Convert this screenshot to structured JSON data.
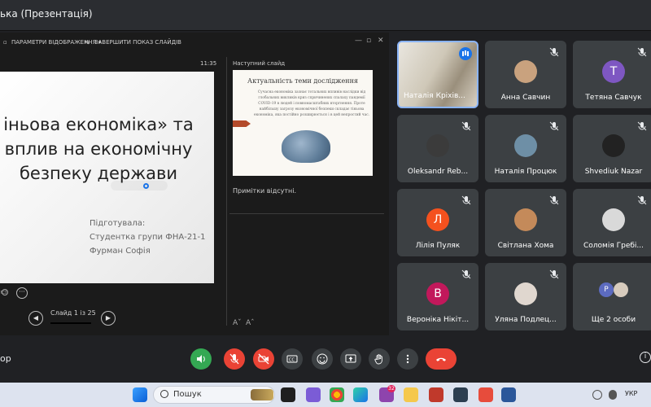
{
  "window": {
    "title": "ька (Презентація)"
  },
  "presenter": {
    "toolbar": {
      "display_settings": "ПАРАМЕТРИ ВІДОБРАЖЕННЯ ▾",
      "end_show": "ЗАВЕРШИТИ ПОКАЗ СЛАЙДІВ"
    },
    "clock": "11:35",
    "next_slide_label": "Наступний слайд",
    "current_slide": {
      "title_lines": [
        "іньова економіка» та",
        "вплив на економічну",
        "безпеку держави"
      ],
      "author_lines": [
        "Підготувала:",
        "Студентка групи ФНА-21-1",
        "Фурман Софія"
      ]
    },
    "next_slide": {
      "title": "Актуальність теми дослідження",
      "text": "Сучасна економіка зазнає тотальних впливів наслідки від глобальних викликів криз спричинених спалаху пандемії COVID-19 в людей і повномасштабних вторгнення. Проте найбільшу загрозу економічної безпеки складає тіньова економіка, яка постійно розширюється і в цей непростий час."
    },
    "notes": "Примітки відсутні.",
    "slide_counter": "Слайд 1 із 25"
  },
  "participants": [
    {
      "name": "Наталія Кріхів...",
      "type": "video",
      "speaking": true
    },
    {
      "name": "Анна Савчин",
      "type": "photo",
      "color": "#c9a27e",
      "muted": true
    },
    {
      "name": "Тетяна Савчук",
      "type": "letter",
      "letter": "Т",
      "color": "#7e57c2",
      "muted": true
    },
    {
      "name": "Oleksandr Reb...",
      "type": "photo",
      "color": "#3b3b3b",
      "muted": true
    },
    {
      "name": "Наталія Процюк",
      "type": "photo",
      "color": "#6e8fa6",
      "muted": true
    },
    {
      "name": "Shvediuk Nazar",
      "type": "photo",
      "color": "#222222",
      "muted": true
    },
    {
      "name": "Лілія Пуляк",
      "type": "letter",
      "letter": "Л",
      "color": "#f4511e",
      "muted": true
    },
    {
      "name": "Світлана Хома",
      "type": "photo",
      "color": "#c48a5a",
      "muted": true
    },
    {
      "name": "Соломія Гребі...",
      "type": "photo",
      "color": "#d9d9d9",
      "muted": true
    },
    {
      "name": "Вероніка Нікіт...",
      "type": "letter",
      "letter": "В",
      "color": "#c2185b",
      "muted": true
    },
    {
      "name": "Уляна Подлец...",
      "type": "photo",
      "color": "#e0d7cf",
      "muted": true
    },
    {
      "name": "Ще 2 особи",
      "type": "more",
      "letter": "Р",
      "color": "#5c6bc0"
    }
  ],
  "meet_bar": {
    "left_text": "ор"
  },
  "taskbar": {
    "search_label": "Пошук",
    "language": "УКР",
    "badge_count": "32"
  }
}
